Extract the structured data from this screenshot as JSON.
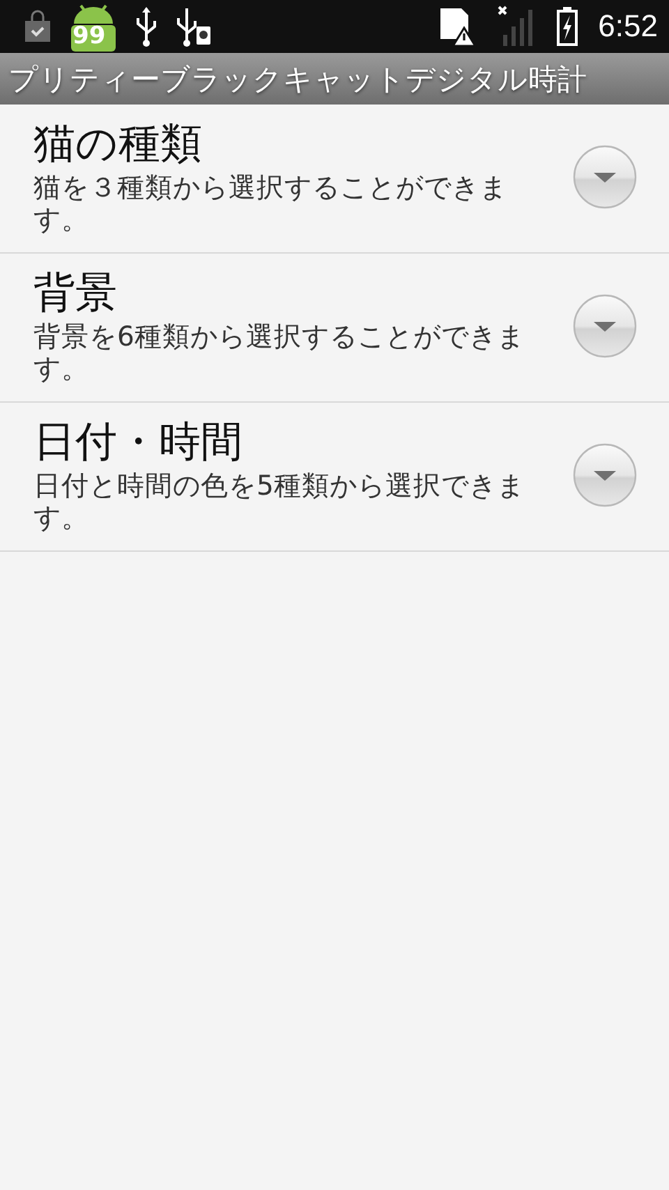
{
  "status_bar": {
    "notification_badge": "99",
    "time": "6:52"
  },
  "title_bar": {
    "title": "プリティーブラックキャットデジタル時計"
  },
  "settings": [
    {
      "title": "猫の種類",
      "summary": "猫を３種類から選択することができます。",
      "expanded": false
    },
    {
      "title": "背景",
      "summary": "背景を6種類から選択することができます。",
      "expanded": false
    },
    {
      "title": "日付・時間",
      "summary": "日付と時間の色を5種類から選択できます。",
      "expanded": false
    }
  ]
}
